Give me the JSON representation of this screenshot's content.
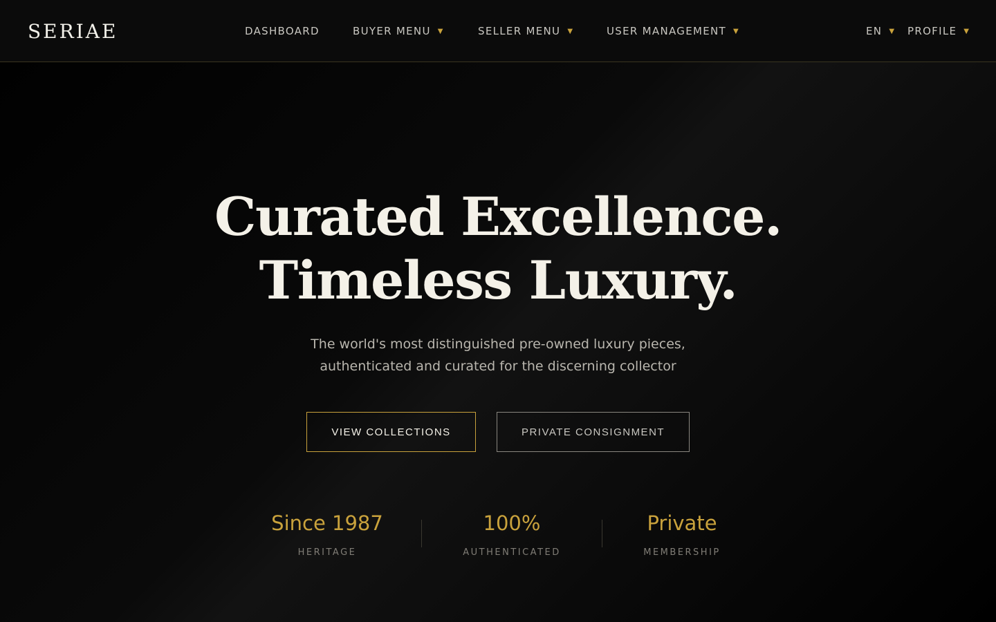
{
  "brand": {
    "name": "SERIAE"
  },
  "nav": {
    "dashboard": "DASHBOARD",
    "buyer_menu": "BUYER MENU",
    "seller_menu": "SELLER MENU",
    "user_management": "USER MANAGEMENT",
    "language": "EN",
    "profile": "PROFILE",
    "caret_icon": "▼"
  },
  "hero": {
    "title_line1": "Curated Excellence.",
    "title_line2": "Timeless Luxury.",
    "subtitle_line1": "The world's most distinguished pre-owned luxury pieces,",
    "subtitle_line2": "authenticated and curated for the discerning collector",
    "primary_button": "VIEW COLLECTIONS",
    "secondary_button": "PRIVATE CONSIGNMENT"
  },
  "stats": [
    {
      "value": "Since 1987",
      "label": "HERITAGE"
    },
    {
      "value": "100%",
      "label": "AUTHENTICATED"
    },
    {
      "value": "Private",
      "label": "MEMBERSHIP"
    }
  ],
  "colors": {
    "accent_gold": "#c9a23c",
    "background": "#000000",
    "header_bg": "#0b0b0b",
    "title_text": "#f4f1e8"
  }
}
